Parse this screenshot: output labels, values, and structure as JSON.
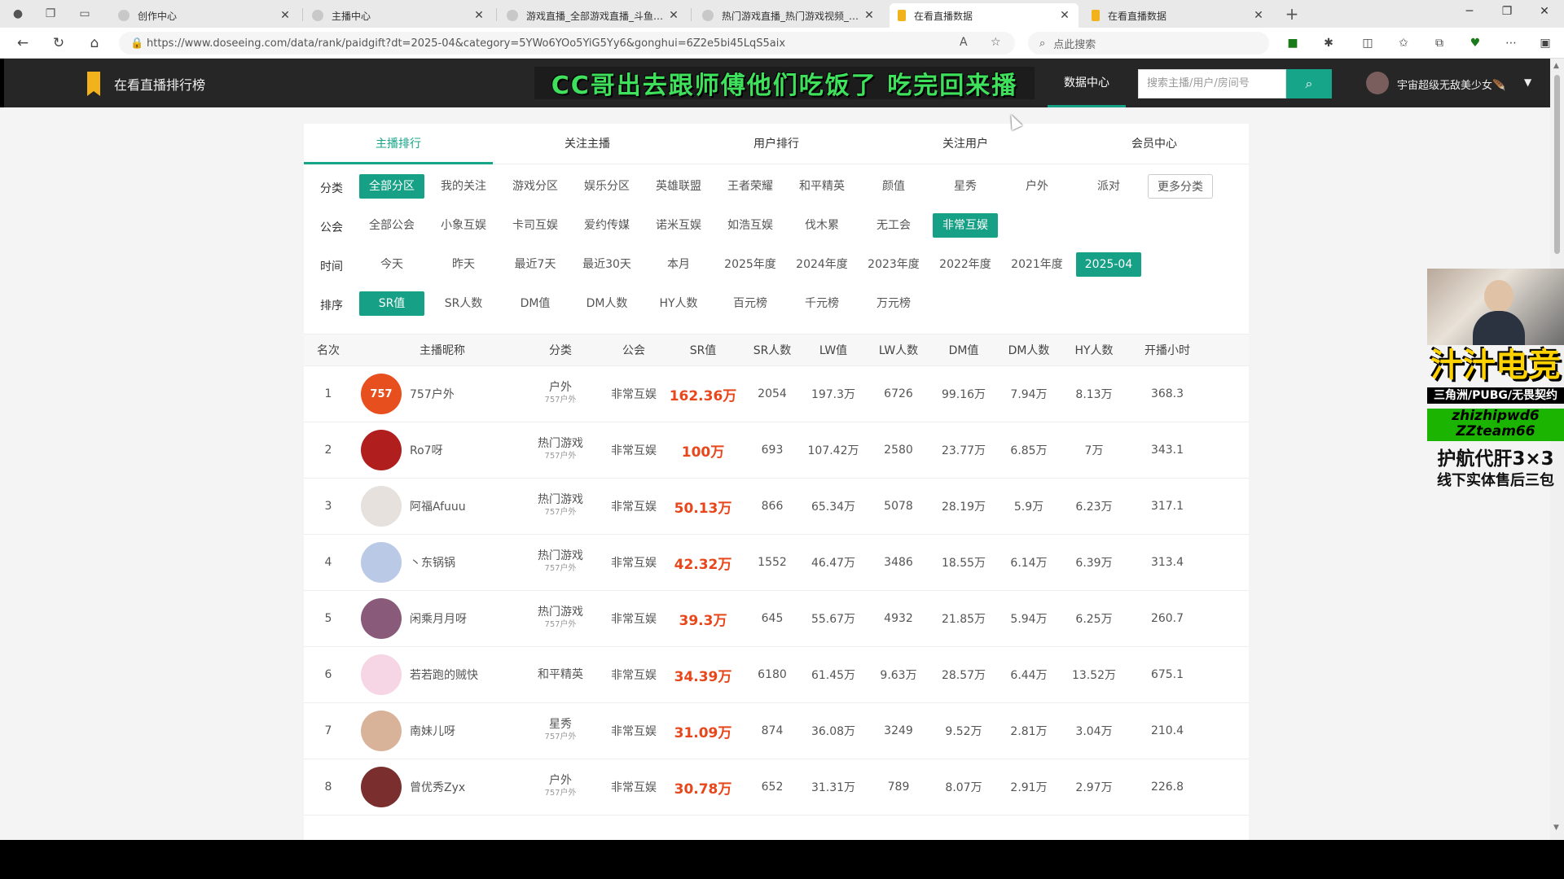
{
  "browser": {
    "tabs": [
      {
        "title": "创作中心",
        "active": false
      },
      {
        "title": "主播中心",
        "active": false
      },
      {
        "title": "游戏直播_全部游戏直播_斗鱼直播",
        "active": false
      },
      {
        "title": "热门游戏直播_热门游戏视频_热门",
        "active": false
      },
      {
        "title": "在看直播数据",
        "active": true
      },
      {
        "title": "在看直播数据",
        "active": false
      }
    ],
    "new_tab": "+",
    "url": "https://www.doseeing.com/data/rank/paidgift?dt=2025-04&category=5YWo6YOo5YiG5Yy6&gonghui=6Z2e5bi45LqS5aix",
    "search_placeholder": "点此搜索"
  },
  "site": {
    "logo_text": "在看直播排行榜",
    "banner_text": "CC哥出去跟师傅他们吃饭了 吃完回来播",
    "nav_data_center": "数据中心",
    "search_placeholder": "搜索主播/用户/房间号",
    "user_name": "宇宙超级无敌美少女🪶"
  },
  "tabs": [
    {
      "label": "主播排行",
      "active": true
    },
    {
      "label": "关注主播",
      "active": false
    },
    {
      "label": "用户排行",
      "active": false
    },
    {
      "label": "关注用户",
      "active": false
    },
    {
      "label": "会员中心",
      "active": false
    }
  ],
  "filters": {
    "category": {
      "label": "分类",
      "options": [
        "全部分区",
        "我的关注",
        "游戏分区",
        "娱乐分区",
        "英雄联盟",
        "王者荣耀",
        "和平精英",
        "颜值",
        "星秀",
        "户外",
        "派对",
        "更多分类"
      ],
      "selected": 0
    },
    "guild": {
      "label": "公会",
      "options": [
        "全部公会",
        "小象互娱",
        "卡司互娱",
        "爱约传媒",
        "诺米互娱",
        "如浩互娱",
        "伐木累",
        "无工会",
        "非常互娱"
      ],
      "selected": 8
    },
    "time": {
      "label": "时间",
      "options": [
        "今天",
        "昨天",
        "最近7天",
        "最近30天",
        "本月",
        "2025年度",
        "2024年度",
        "2023年度",
        "2022年度",
        "2021年度",
        "2025-04"
      ],
      "selected": 10
    },
    "sort": {
      "label": "排序",
      "options": [
        "SR值",
        "SR人数",
        "DM值",
        "DM人数",
        "HY人数",
        "百元榜",
        "千元榜",
        "万元榜"
      ],
      "selected": 0
    }
  },
  "table": {
    "headers": [
      "名次",
      "主播昵称",
      "分类",
      "公会",
      "SR值",
      "SR人数",
      "LW值",
      "LW人数",
      "DM值",
      "DM人数",
      "HY人数",
      "开播小时"
    ],
    "rows": [
      {
        "rank": "1",
        "name": "757户外",
        "avatar_text": "757",
        "avatar_color": "#e84f1e",
        "cat": "户外",
        "sub": "757户外",
        "guild": "非常互娱",
        "sr": "162.36万",
        "sr_cnt": "2054",
        "lw": "197.3万",
        "lw_cnt": "6726",
        "dm": "99.16万",
        "dm_cnt": "7.94万",
        "hy": "8.13万",
        "hours": "368.3"
      },
      {
        "rank": "2",
        "name": "Ro7呀",
        "avatar_text": "",
        "avatar_color": "#b01e1e",
        "cat": "热门游戏",
        "sub": "757户外",
        "guild": "非常互娱",
        "sr": "100万",
        "sr_cnt": "693",
        "lw": "107.42万",
        "lw_cnt": "2580",
        "dm": "23.77万",
        "dm_cnt": "6.85万",
        "hy": "7万",
        "hours": "343.1"
      },
      {
        "rank": "3",
        "name": "阿福Afuuu",
        "avatar_text": "",
        "avatar_color": "#e6e1dc",
        "cat": "热门游戏",
        "sub": "757户外",
        "guild": "非常互娱",
        "sr": "50.13万",
        "sr_cnt": "866",
        "lw": "65.34万",
        "lw_cnt": "5078",
        "dm": "28.19万",
        "dm_cnt": "5.9万",
        "hy": "6.23万",
        "hours": "317.1"
      },
      {
        "rank": "4",
        "name": "丶东锅锅",
        "avatar_text": "",
        "avatar_color": "#b9c9e6",
        "cat": "热门游戏",
        "sub": "757户外",
        "guild": "非常互娱",
        "sr": "42.32万",
        "sr_cnt": "1552",
        "lw": "46.47万",
        "lw_cnt": "3486",
        "dm": "18.55万",
        "dm_cnt": "6.14万",
        "hy": "6.39万",
        "hours": "313.4"
      },
      {
        "rank": "5",
        "name": "闲乘月月呀",
        "avatar_text": "",
        "avatar_color": "#8a5a7a",
        "cat": "热门游戏",
        "sub": "757户外",
        "guild": "非常互娱",
        "sr": "39.3万",
        "sr_cnt": "645",
        "lw": "55.67万",
        "lw_cnt": "4932",
        "dm": "21.85万",
        "dm_cnt": "5.94万",
        "hy": "6.25万",
        "hours": "260.7"
      },
      {
        "rank": "6",
        "name": "若若跑的贼快",
        "avatar_text": "",
        "avatar_color": "#f6d6e4",
        "cat": "和平精英",
        "sub": "",
        "guild": "非常互娱",
        "sr": "34.39万",
        "sr_cnt": "6180",
        "lw": "61.45万",
        "lw_cnt": "9.63万",
        "dm": "28.57万",
        "dm_cnt": "6.44万",
        "hy": "13.52万",
        "hours": "675.1"
      },
      {
        "rank": "7",
        "name": "南妹儿呀",
        "avatar_text": "",
        "avatar_color": "#d9b29a",
        "cat": "星秀",
        "sub": "757户外",
        "guild": "非常互娱",
        "sr": "31.09万",
        "sr_cnt": "874",
        "lw": "36.08万",
        "lw_cnt": "3249",
        "dm": "9.52万",
        "dm_cnt": "2.81万",
        "hy": "3.04万",
        "hours": "210.4"
      },
      {
        "rank": "8",
        "name": "曾优秀Zyx",
        "avatar_text": "",
        "avatar_color": "#7a2e2e",
        "cat": "户外",
        "sub": "757户外",
        "guild": "非常互娱",
        "sr": "30.78万",
        "sr_cnt": "652",
        "lw": "31.31万",
        "lw_cnt": "789",
        "dm": "8.07万",
        "dm_cnt": "2.91万",
        "hy": "2.97万",
        "hours": "226.8"
      }
    ]
  },
  "overlay": {
    "title": "汁汁电竞",
    "line1": "三角洲/PUBG/无畏契约",
    "line2a": "zhizhipwd6",
    "line2b": "ZZteam66",
    "line3": "护航代肝3×3",
    "line4": "线下实体售后三包"
  },
  "colors": {
    "accent": "#16a085",
    "sr_red": "#e8461b",
    "header_bg": "#262626"
  }
}
